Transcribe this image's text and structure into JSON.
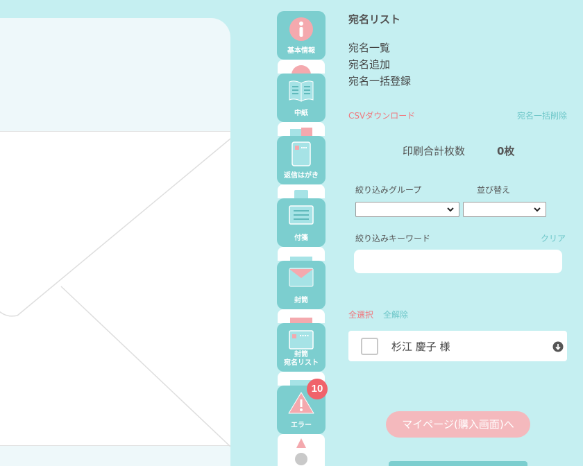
{
  "tabs": [
    {
      "label": "基本情報",
      "icon": "info-icon"
    },
    {
      "label": "中紙",
      "icon": "open-book-icon"
    },
    {
      "label": "返信はがき",
      "icon": "reply-postcard-icon"
    },
    {
      "label": "付箋",
      "icon": "sticky-note-icon"
    },
    {
      "label": "封筒",
      "icon": "envelope-icon"
    },
    {
      "label": "封筒\n宛名リスト",
      "icon": "address-card-icon"
    },
    {
      "label": "エラー",
      "icon": "warning-icon",
      "badge": "10"
    }
  ],
  "panel": {
    "title": "宛名リスト",
    "menu": [
      "宛名一覧",
      "宛名追加",
      "宛名一括登録"
    ],
    "csv_download": "CSVダウンロード",
    "bulk_delete": "宛名一括削除",
    "print_total_label": "印刷合計枚数",
    "print_total_value": "0枚",
    "filter_group_label": "絞り込みグループ",
    "sort_label": "並び替え",
    "filter_keyword_label": "絞り込みキーワード",
    "clear_label": "クリア",
    "keyword_value": "",
    "select_all": "全選択",
    "deselect_all": "全解除",
    "recipients": [
      {
        "name": "杉江 慶子 様"
      }
    ],
    "mypage_button": "マイページ(購入画面)へ"
  },
  "colors": {
    "background": "#c5eff1",
    "tab": "#7ccecf",
    "accent_pink": "#f0777d",
    "badge": "#f0636b",
    "button_pink": "#f4b9bd"
  }
}
